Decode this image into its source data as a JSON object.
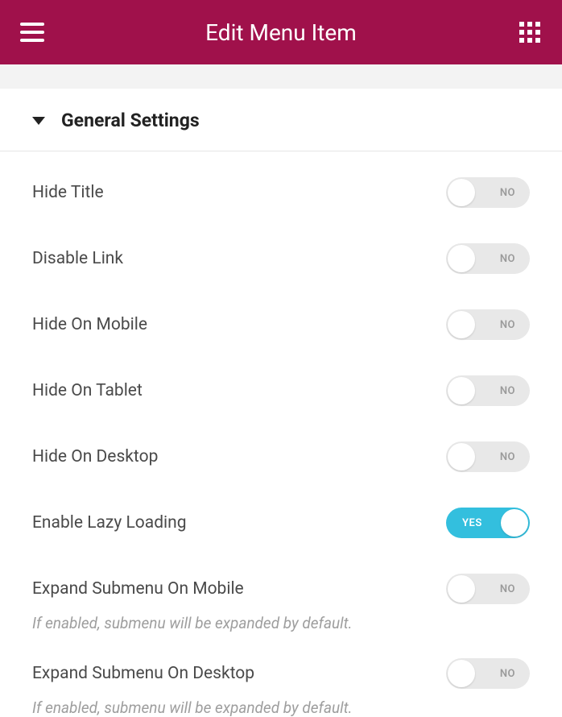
{
  "header": {
    "title": "Edit Menu Item"
  },
  "section": {
    "title": "General Settings"
  },
  "toggle_labels": {
    "on": "YES",
    "off": "NO"
  },
  "settings": [
    {
      "label": "Hide Title",
      "on": false,
      "hint": null
    },
    {
      "label": "Disable Link",
      "on": false,
      "hint": null
    },
    {
      "label": "Hide On Mobile",
      "on": false,
      "hint": null
    },
    {
      "label": "Hide On Tablet",
      "on": false,
      "hint": null
    },
    {
      "label": "Hide On Desktop",
      "on": false,
      "hint": null
    },
    {
      "label": "Enable Lazy Loading",
      "on": true,
      "hint": null
    },
    {
      "label": "Expand Submenu On Mobile",
      "on": false,
      "hint": "If enabled, submenu will be expanded by default."
    },
    {
      "label": "Expand Submenu On Desktop",
      "on": false,
      "hint": "If enabled, submenu will be expanded by default."
    }
  ]
}
